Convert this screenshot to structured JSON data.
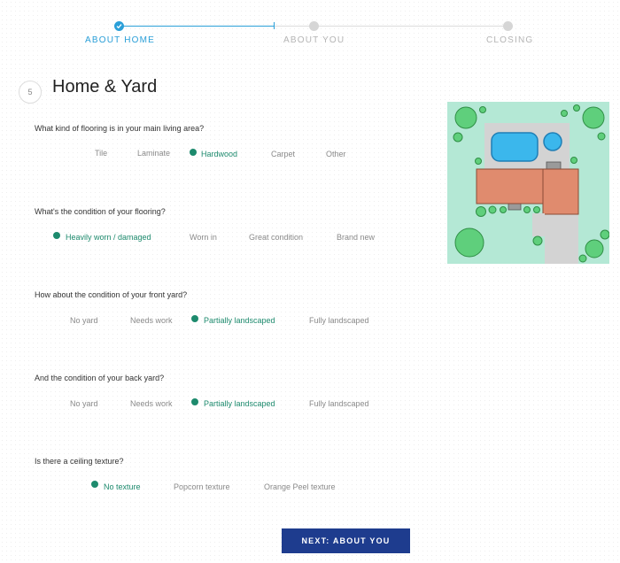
{
  "stepper": {
    "steps": [
      {
        "label": "ABOUT HOME",
        "state": "current"
      },
      {
        "label": "ABOUT YOU",
        "state": "upcoming"
      },
      {
        "label": "CLOSING",
        "state": "upcoming"
      }
    ],
    "colors": {
      "active": "#2a9fd8",
      "inactive": "#d6d6d6"
    }
  },
  "section": {
    "number": "5",
    "title": "Home & Yard"
  },
  "questions": [
    {
      "text": "What kind of flooring is in your main living area?",
      "options": [
        "Tile",
        "Laminate",
        "Hardwood",
        "Carpet",
        "Other"
      ],
      "selected": "Hardwood"
    },
    {
      "text": "What's the condition of your flooring?",
      "options": [
        "Heavily worn / damaged",
        "Worn in",
        "Great condition",
        "Brand new"
      ],
      "selected": "Heavily worn / damaged"
    },
    {
      "text": "How about the condition of your front yard?",
      "options": [
        "No yard",
        "Needs work",
        "Partially landscaped",
        "Fully landscaped"
      ],
      "selected": "Partially landscaped"
    },
    {
      "text": "And the condition of your back yard?",
      "options": [
        "No yard",
        "Needs work",
        "Partially landscaped",
        "Fully landscaped"
      ],
      "selected": "Partially landscaped"
    },
    {
      "text": "Is there a ceiling texture?",
      "options": [
        "No texture",
        "Popcorn texture",
        "Orange Peel texture"
      ],
      "selected": "No texture"
    }
  ],
  "next_button": {
    "label": "NEXT: ABOUT YOU"
  },
  "colors": {
    "selected": "#1d8a6d",
    "button": "#1e3c8e",
    "lawn": "#b4e8d5",
    "roof": "#e08b6e",
    "pool": "#3bb7ec"
  }
}
